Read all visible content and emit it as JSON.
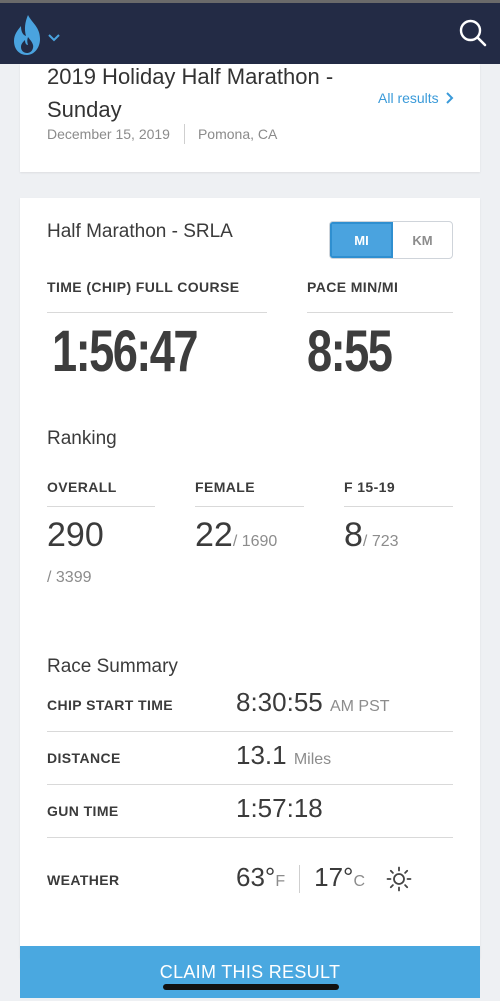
{
  "event": {
    "title": "2019 Holiday Half Marathon - Sunday",
    "date": "December 15, 2019",
    "location": "Pomona, CA",
    "all_results_label": "All results"
  },
  "race": {
    "name": "Half Marathon - SRLA",
    "unit_toggle": {
      "selected": "MI",
      "options": [
        "MI",
        "KM"
      ]
    },
    "time_label": "TIME (CHIP) FULL COURSE",
    "time_value": "1:56:47",
    "pace_label": "PACE MIN/MI",
    "pace_value": "8:55"
  },
  "ranking": {
    "title": "Ranking",
    "overall": {
      "label": "OVERALL",
      "value": "290",
      "of": "/ 3399"
    },
    "gender": {
      "label": "FEMALE",
      "value": "22",
      "of": "/ 1690"
    },
    "age_group": {
      "label": "F 15-19",
      "value": "8",
      "of": "/ 723"
    }
  },
  "summary": {
    "title": "Race Summary",
    "rows": [
      {
        "label": "CHIP START TIME",
        "value": "8:30:55",
        "unit": "AM PST"
      },
      {
        "label": "DISTANCE",
        "value": "13.1",
        "unit": "Miles"
      },
      {
        "label": "GUN TIME",
        "value": "1:57:18",
        "unit": ""
      }
    ],
    "weather": {
      "label": "WEATHER",
      "temp_f": "63°",
      "unit_f": "F",
      "temp_c": "17°",
      "unit_c": "C",
      "icon": "sun-icon"
    }
  },
  "claim_button": "CLAIM THIS RESULT",
  "colors": {
    "header_bg": "#232b45",
    "accent_blue": "#4aa8e0",
    "flame_blue": "#4aa3df"
  }
}
